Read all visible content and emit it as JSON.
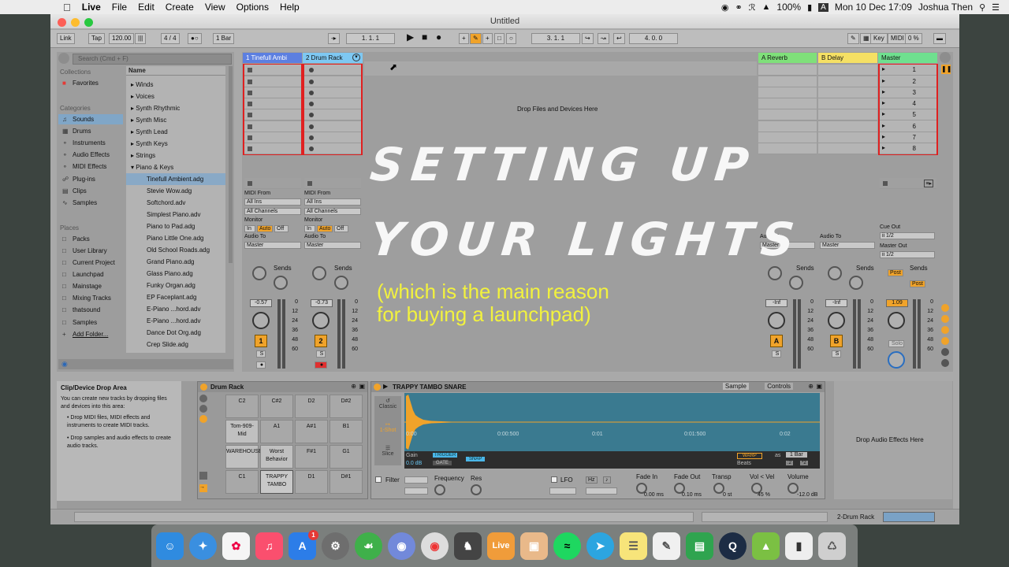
{
  "menubar": {
    "apple": "",
    "app": "Live",
    "items": [
      "File",
      "Edit",
      "Create",
      "View",
      "Options",
      "Help"
    ],
    "battery": "100%",
    "kbd": "A",
    "datetime": "Mon 10 Dec  17:09",
    "user": "Joshua Then"
  },
  "window": {
    "title": "Untitled"
  },
  "control": {
    "link": "Link",
    "tap": "Tap",
    "tempo": "120.00",
    "sig": "4 / 4",
    "quant": "1 Bar",
    "pos": "1.   1.   1",
    "loopstart": "3.   1.   1",
    "looplen": "4.   0.   0",
    "key": "Key",
    "midi": "MIDI",
    "cpu": "0 %"
  },
  "browser": {
    "search_placeholder": "Search (Cmd + F)",
    "collections": "Collections",
    "favorites": "Favorites",
    "categories": "Categories",
    "places": "Places",
    "name_col": "Name",
    "category_items": [
      "Sounds",
      "Drums",
      "Instruments",
      "Audio Effects",
      "MIDI Effects",
      "Plug-ins",
      "Clips",
      "Samples"
    ],
    "place_items": [
      "Packs",
      "User Library",
      "Current Project",
      "Launchpad",
      "Mainstage",
      "Mixing Tracks",
      "thatsound",
      "Samples",
      "Add Folder..."
    ],
    "folders": [
      "Winds",
      "Voices",
      "Synth Rhythmic",
      "Synth Misc",
      "Synth Lead",
      "Synth Keys",
      "Strings",
      "Piano & Keys"
    ],
    "files": [
      "Tinefull Ambient.adg",
      "Stevie Wow.adg",
      "Softchord.adv",
      "Simplest Piano.adv",
      "Piano to Pad.adg",
      "Piano Little One.adg",
      "Old School Roads.adg",
      "Grand Piano.adg",
      "Glass Piano.adg",
      "Funky Organ.adg",
      "EP Faceplant.adg",
      "E-Piano ...hord.adv",
      "E-Piano ...hord.adv",
      "Dance Dot Org.adg",
      "Crep Slide.adg"
    ]
  },
  "tracks": [
    {
      "name": "1 Tinefull Ambi",
      "color": "#5c7fe0"
    },
    {
      "name": "2 Drum Rack",
      "color": "#7ec8f2"
    }
  ],
  "returns": [
    {
      "name": "A Reverb",
      "color": "#7fe07a"
    },
    {
      "name": "B Delay",
      "color": "#f5e064"
    },
    {
      "name": "Master",
      "color": "#6fe08f"
    }
  ],
  "master_scenes": [
    "1",
    "2",
    "3",
    "4",
    "5",
    "6",
    "7",
    "8"
  ],
  "drop_files": "Drop Files and Devices Here",
  "io": {
    "midi_from": "MIDI From",
    "all_ins": "All Ins",
    "all_channels": "All Channels",
    "monitor": "Monitor",
    "in": "In",
    "auto": "Auto",
    "off": "Off",
    "audio_to": "Audio To",
    "master": "Master",
    "cue_out": "Cue Out",
    "cue_val": "ii 1/2",
    "master_out": "Master Out",
    "master_out_val": "ii 1/2",
    "sends": "Sends",
    "post": "Post"
  },
  "mixer": {
    "vol1": "-0.57",
    "vol2": "-0.73",
    "volA": "-Inf",
    "volB": "-Inf",
    "volM": "1.09",
    "num1": "1",
    "num2": "2",
    "numA": "A",
    "numB": "B",
    "solo": "Solo",
    "s": "S",
    "scale": [
      "0",
      "12",
      "24",
      "36",
      "48",
      "60"
    ],
    "scale_m": [
      "0",
      "12",
      "24",
      "36",
      "48",
      "60"
    ]
  },
  "overlay": {
    "line1": "SETTING UP",
    "line2": "YOUR LIGHTS",
    "line3": "(which is the main reason",
    "line4": "for buying a launchpad)"
  },
  "clipdev": {
    "title": "Clip/Device Drop Area",
    "body": "You can create new tracks by dropping files and devices into this area:",
    "b1": "Drop MIDI files, MIDI effects and instruments to create MIDI tracks.",
    "b2": "Drop samples and audio effects to create audio tracks."
  },
  "drumrack": {
    "title": "Drum Rack",
    "pads": [
      [
        "C2",
        "C#2",
        "D2",
        "D#2"
      ],
      [
        "Tom-909-Mid",
        "A1",
        "A#1",
        "B1"
      ],
      [
        "WAREHOUSE",
        "Worst Behavior",
        "F#1",
        "G1"
      ],
      [
        "C1",
        "TRAPPY TAMBO",
        "D1",
        "D#1"
      ]
    ]
  },
  "sampler": {
    "title": "TRAPPY TAMBO SNARE",
    "tab_sample": "Sample",
    "tab_controls": "Controls",
    "classic": "Classic",
    "oneshot": "1-Shot",
    "slice": "Slice",
    "gain": "Gain",
    "gain_val": "0.0 dB",
    "trigger": "TRIGGER",
    "gate": "GATE",
    "snap": "SNAP",
    "warp": "WARP",
    "as": "as",
    "bars": "1 Bar",
    "beats": "Beats",
    "t0": "0:00",
    "t1": "0:00:500",
    "t2": "0:01",
    "t3": "0:01:500",
    "t4": "0:02",
    "filter": "Filter",
    "frequency": "Frequency",
    "res": "Res",
    "lfo": "LFO",
    "hz": "Hz",
    "fadein": "Fade In",
    "fadein_val": "0.00 ms",
    "fadeout": "Fade Out",
    "fadeout_val": "0.10 ms",
    "transp": "Transp",
    "transp_val": "0 st",
    "velvol": "Vol < Vel",
    "velvol_val": "45 %",
    "volume": "Volume",
    "volume_val": "-12.0 dB",
    "half": ":2",
    "dbl": "*2"
  },
  "audiofx": "Drop Audio Effects Here",
  "status": {
    "track": "2-Drum Rack"
  },
  "dock": [
    "Finder",
    "Safari",
    "Photos",
    "Music",
    "App Store",
    "System Preferences",
    "Evernote",
    "Discord",
    "Chrome",
    "Game",
    "Live",
    "Preview",
    "Spotify",
    "Telegram",
    "Notes",
    "TextEdit",
    "Numbers",
    "QuickTime",
    "Android Transfer",
    "Zip",
    "Trash"
  ],
  "dock_badge": "1"
}
